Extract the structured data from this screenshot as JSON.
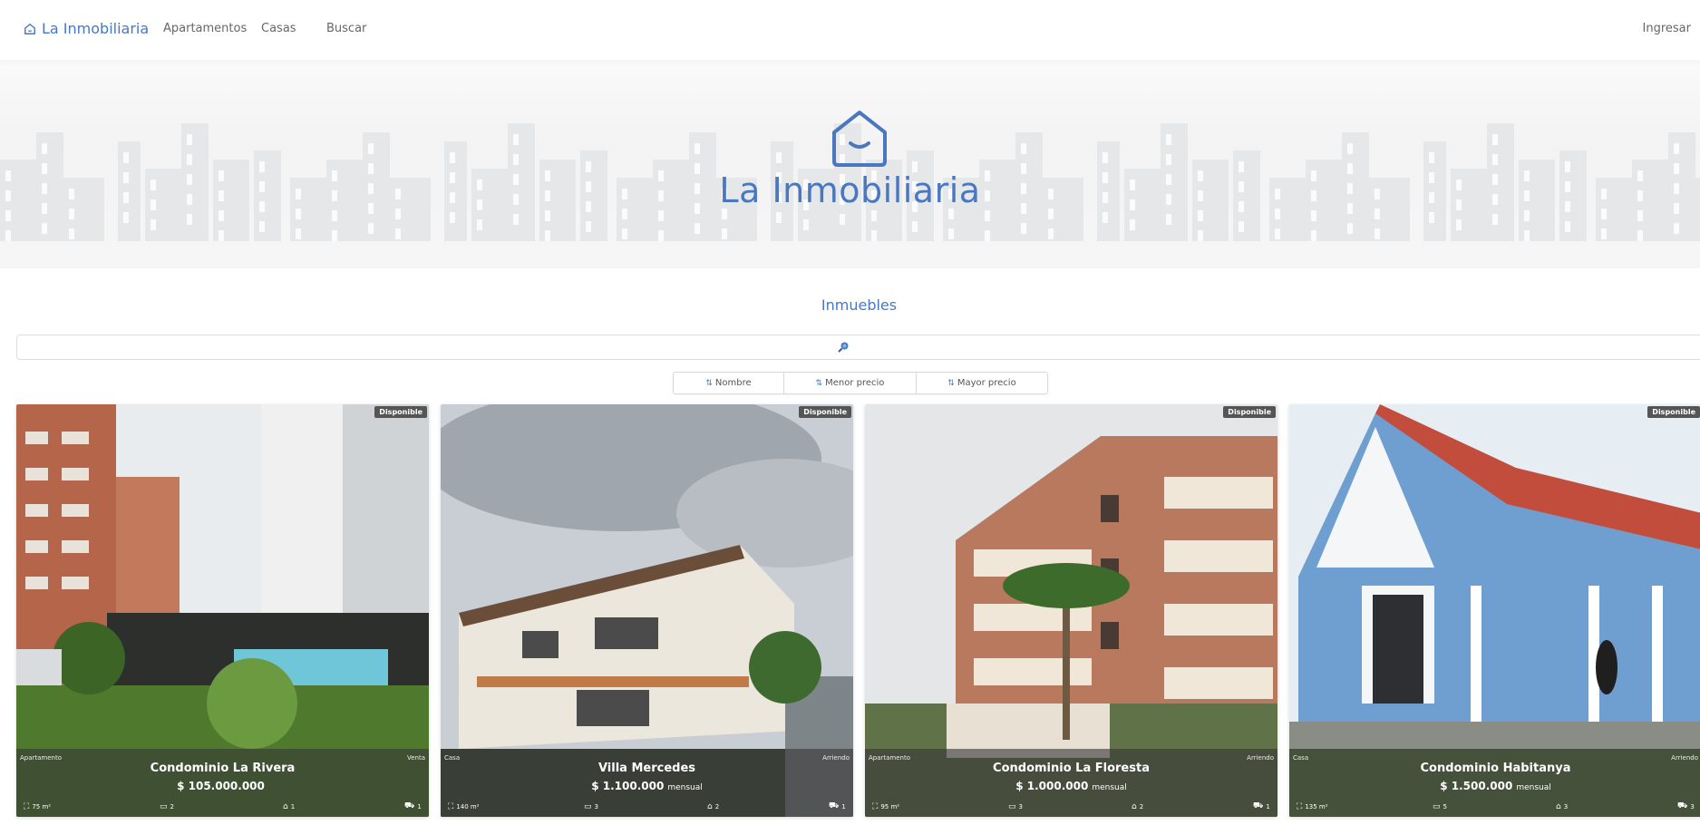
{
  "navbar": {
    "brand": "La Inmobiliaria",
    "links": [
      "Apartamentos",
      "Casas",
      "Buscar"
    ],
    "login": "Ingresar"
  },
  "hero": {
    "title": "La Inmobiliaria"
  },
  "section_title": "Inmuebles",
  "search": {
    "placeholder": "",
    "icon": "search-icon"
  },
  "sort": [
    {
      "label": "Nombre",
      "icon": "sort-icon"
    },
    {
      "label": "Menor precio",
      "icon": "sort-asc-icon"
    },
    {
      "label": "Mayor precio",
      "icon": "sort-desc-icon"
    }
  ],
  "colors": {
    "brand": "#4a78c0",
    "overlay": "#373737",
    "badge": "#555555"
  },
  "listings": [
    {
      "status": "Disponible",
      "type": "Apartamento",
      "deal": "Venta",
      "name": "Condominio La Rivera",
      "price": "$ 105.000.000",
      "unit": "",
      "area": "75 m²",
      "beds": "2",
      "baths": "1",
      "parking": "1"
    },
    {
      "status": "Disponible",
      "type": "Casa",
      "deal": "Arriendo",
      "name": "Villa Mercedes",
      "price": "$ 1.100.000",
      "unit": "mensual",
      "area": "140 m²",
      "beds": "3",
      "baths": "2",
      "parking": "1"
    },
    {
      "status": "Disponible",
      "type": "Apartamento",
      "deal": "Arriendo",
      "name": "Condominio La Floresta",
      "price": "$ 1.000.000",
      "unit": "mensual",
      "area": "95 m²",
      "beds": "3",
      "baths": "2",
      "parking": "1"
    },
    {
      "status": "Disponible",
      "type": "Casa",
      "deal": "Arriendo",
      "name": "Condominio Habitanya",
      "price": "$ 1.500.000",
      "unit": "mensual",
      "area": "135 m²",
      "beds": "5",
      "baths": "3",
      "parking": "3"
    }
  ]
}
